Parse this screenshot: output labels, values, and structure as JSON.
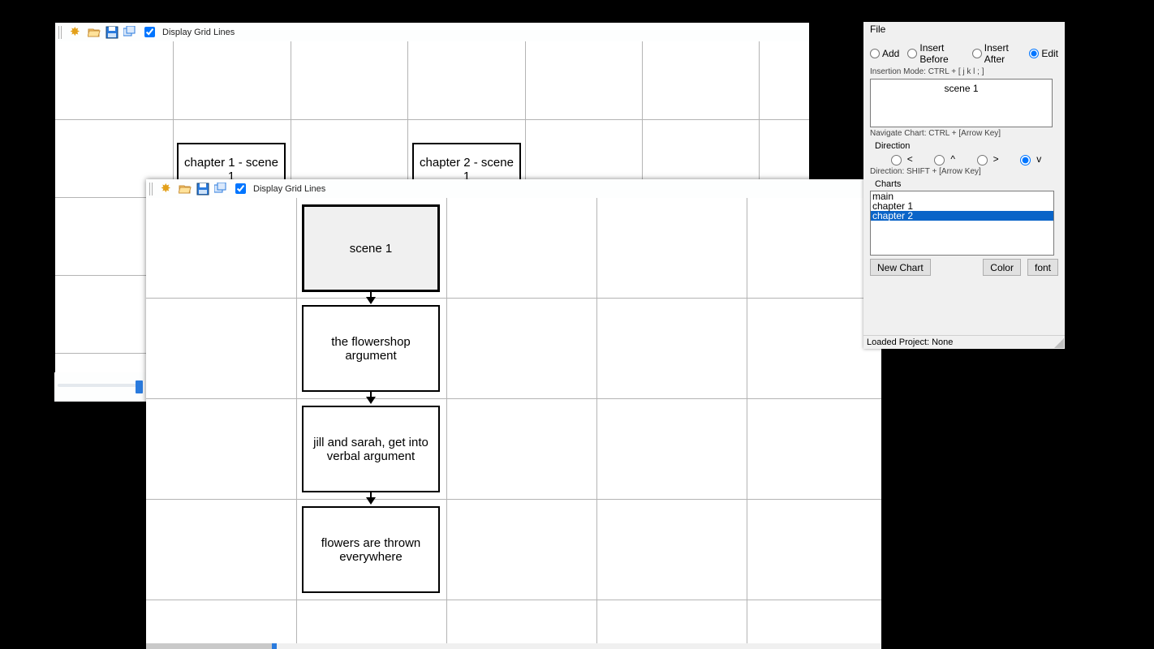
{
  "toolbar": {
    "display_grid_label": "Display Grid Lines",
    "display_grid_checked": true
  },
  "back_chart": {
    "nodes": [
      {
        "label": "chapter 1 - scene 1"
      },
      {
        "label": "chapter 2 - scene 1"
      }
    ]
  },
  "front_chart": {
    "nodes": [
      {
        "label": "scene 1",
        "selected": true
      },
      {
        "label": "the flowershop argument"
      },
      {
        "label": "jill and sarah, get into verbal argument"
      },
      {
        "label": "flowers are thrown everywhere"
      }
    ]
  },
  "side": {
    "menu_file": "File",
    "mode": {
      "add": "Add",
      "insert_before": "Insert Before",
      "insert_after": "Insert After",
      "edit": "Edit",
      "selected": "edit",
      "hint": "Insertion Mode: CTRL + [ j  k  l  ; ]"
    },
    "edit_text": "scene 1",
    "nav_hint": "Navigate Chart: CTRL + [Arrow Key]",
    "direction": {
      "label": "Direction",
      "left": "<",
      "up": "^",
      "right": ">",
      "down": "v",
      "selected": "down",
      "hint": "Direction: SHIFT + [Arrow Key]"
    },
    "charts": {
      "label": "Charts",
      "items": [
        "main",
        "chapter 1",
        "chapter 2"
      ],
      "selected_index": 2,
      "new_chart": "New Chart",
      "color": "Color",
      "font": "font"
    },
    "status": "Loaded Project: None"
  }
}
